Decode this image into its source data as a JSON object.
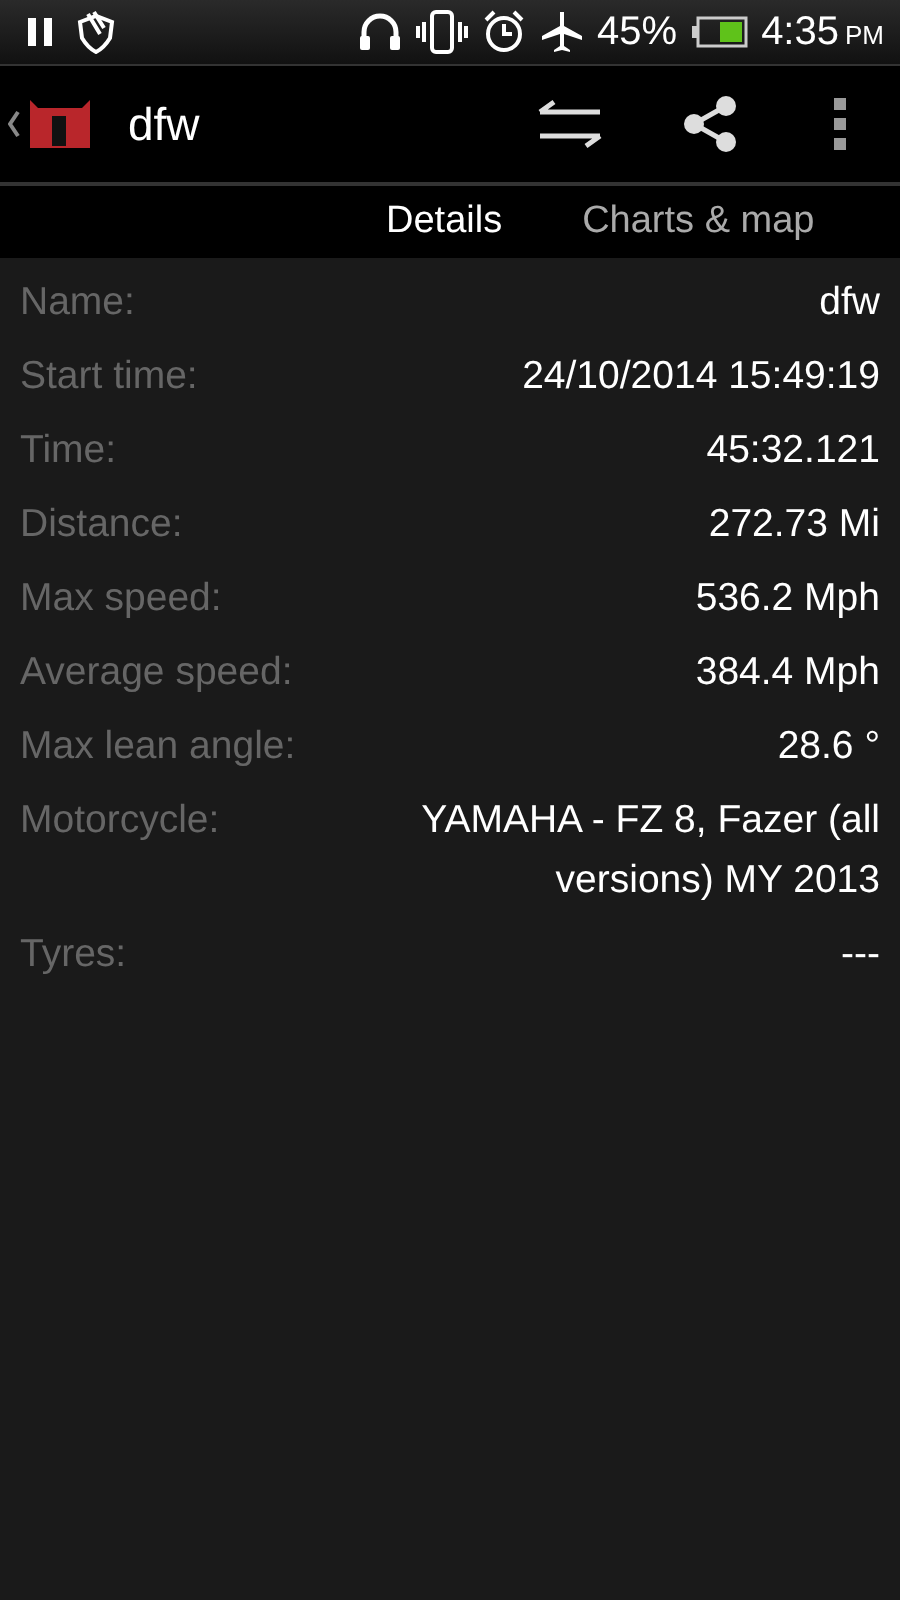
{
  "status_bar": {
    "battery_percent": "45%",
    "time": "4:35",
    "am_pm": "PM"
  },
  "action_bar": {
    "title": "dfw"
  },
  "tabs": [
    {
      "label": "Details",
      "selected": true
    },
    {
      "label": "Charts & map",
      "selected": false
    }
  ],
  "details": [
    {
      "label": "Name:",
      "value": "dfw"
    },
    {
      "label": "Start time:",
      "value": "24/10/2014 15:49:19"
    },
    {
      "label": "Time:",
      "value": "45:32.121"
    },
    {
      "label": "Distance:",
      "value": "272.73 Mi"
    },
    {
      "label": "Max speed:",
      "value": "536.2 Mph"
    },
    {
      "label": "Average speed:",
      "value": "384.4 Mph"
    },
    {
      "label": "Max lean angle:",
      "value": "28.6 °"
    },
    {
      "label": "Motorcycle:",
      "value": "YAMAHA - FZ 8, Fazer (all versions) MY 2013"
    },
    {
      "label": "Tyres:",
      "value": "---"
    }
  ]
}
